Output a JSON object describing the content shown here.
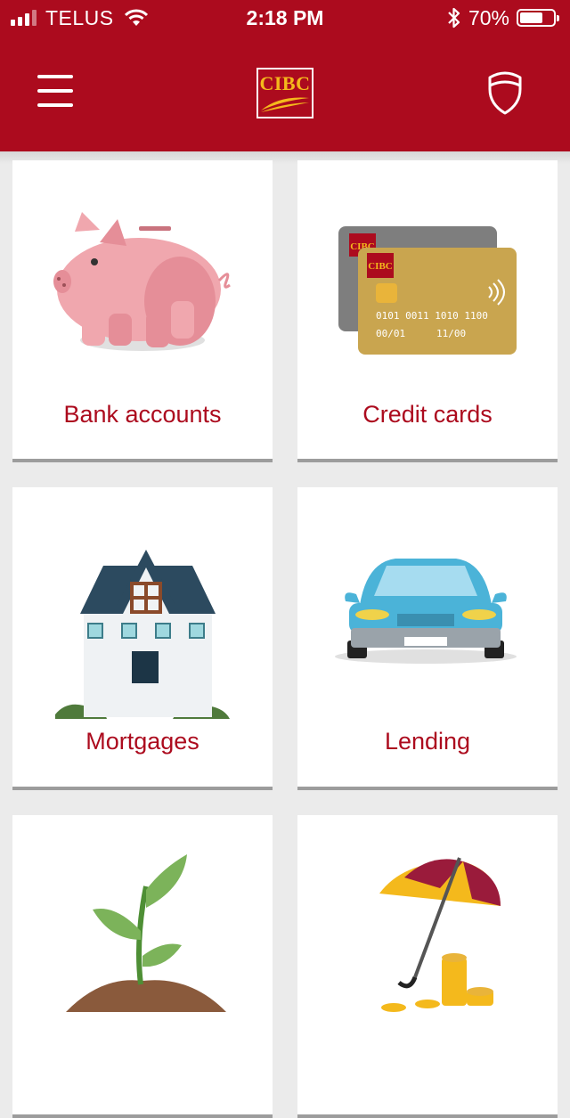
{
  "status_bar": {
    "carrier": "TELUS",
    "time": "2:18 PM",
    "battery_percent": "70%",
    "battery_level": 0.7,
    "icons": [
      "signal-icon",
      "wifi-icon",
      "bluetooth-icon",
      "battery-icon"
    ]
  },
  "header": {
    "logo_text": "CIBC",
    "menu_icon": "hamburger-menu-icon",
    "security_icon": "shield-icon",
    "brand_color": "#ac0b1e",
    "logo_color": "#f4b91c"
  },
  "tiles": [
    {
      "label": "Bank accounts",
      "icon": "piggy-bank-icon"
    },
    {
      "label": "Credit cards",
      "icon": "credit-cards-icon",
      "card_text": {
        "brand": "CIBC",
        "number": "0101 0011 1010 1100",
        "valid_from": "00/01",
        "valid_to": "11/00"
      }
    },
    {
      "label": "Mortgages",
      "icon": "house-icon"
    },
    {
      "label": "Lending",
      "icon": "car-icon"
    },
    {
      "label": "",
      "icon": "plant-icon"
    },
    {
      "label": "",
      "icon": "umbrella-coins-icon"
    }
  ]
}
